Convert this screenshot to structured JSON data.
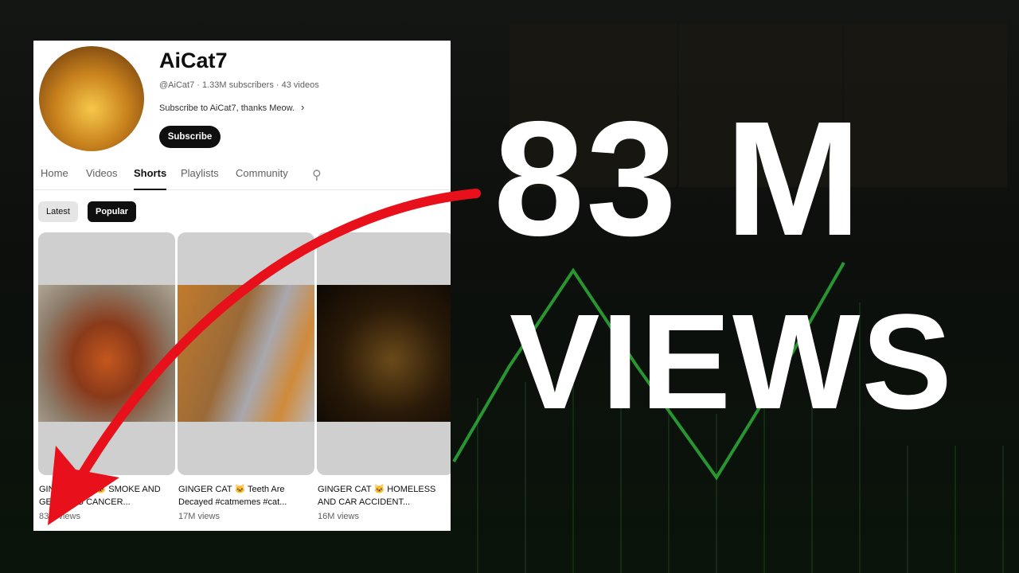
{
  "channel": {
    "name": "AiCat7",
    "meta": "@AiCat7 · 1.33M subscribers · 43 videos",
    "description": "Subscribe to AiCat7, thanks Meow.",
    "subscribe_label": "Subscribe"
  },
  "tabs": [
    {
      "label": "Home"
    },
    {
      "label": "Videos"
    },
    {
      "label": "Shorts",
      "active": true
    },
    {
      "label": "Playlists"
    },
    {
      "label": "Community"
    }
  ],
  "chips": [
    {
      "label": "Latest"
    },
    {
      "label": "Popular",
      "selected": true
    }
  ],
  "shorts": [
    {
      "title": "GINGER CAT 🐱 SMOKE AND GET LUNG CANCER...",
      "views": "83M views"
    },
    {
      "title": "GINGER CAT 🐱 Teeth Are Decayed #catmemes #cat...",
      "views": "17M views"
    },
    {
      "title": "GINGER CAT 🐱 HOMELESS AND CAR ACCIDENT...",
      "views": "16M views"
    }
  ],
  "headline": {
    "line1": "83 M",
    "line2": "VIEWS"
  },
  "colors": {
    "arrow": "#e8101a",
    "chart_green": "#2fb83a",
    "accent_black": "#0f0f0f"
  }
}
